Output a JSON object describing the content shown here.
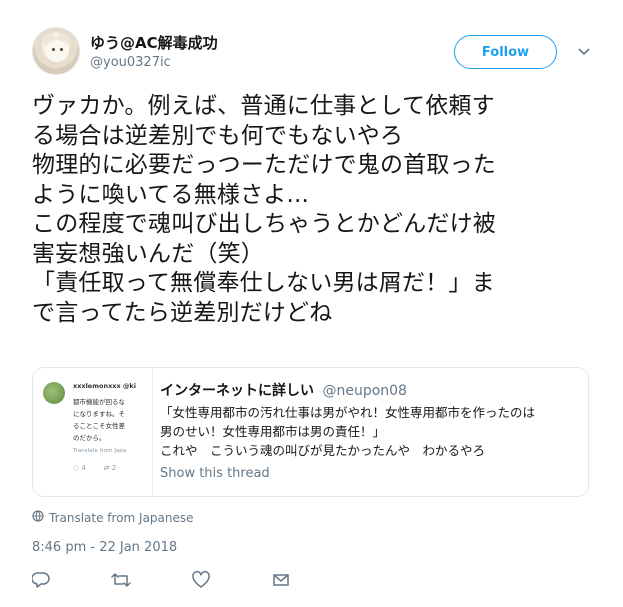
{
  "user": {
    "display_name": "ゆう@AC解毒成功",
    "handle": "@you0327ic"
  },
  "follow_button": {
    "label": "Follow"
  },
  "icons": {
    "caret": "chevron-down-icon",
    "translate": "globe-icon",
    "reply": "reply-icon",
    "retweet": "retweet-icon",
    "like": "heart-icon",
    "dm": "envelope-icon"
  },
  "tweet": {
    "text": "ヴァカか。例えば、普通に仕事として依頼す\nる場合は逆差別でも何でもないやろ\n物理的に必要だっつーただけで鬼の首取った\nように喚いてる無様さよ...\nこの程度で魂叫び出しちゃうとかどんだけ被\n害妄想強いんだ（笑）\n「責任取って無償奉仕しない男は屑だ！」ま\nで言ってたら逆差別だけどね"
  },
  "quoted_tweet": {
    "thumbnail": {
      "name": "xxxlemonxxx @ki",
      "lines": [
        "都市機能が回るな",
        "になりますね。そ",
        "ることこそ女性差",
        "のだから。"
      ],
      "translate": "Translate from Japa",
      "reply_count": "4",
      "retweet_count": "2"
    },
    "author_name": "インターネットに詳しい",
    "author_handle": "@neupon08",
    "text": "「女性専用都市の汚れ仕事は男がやれ！女性専用都市を作ったのは\n男のせい！女性専用都市は男の責任！」\nこれや　こういう魂の叫びが見たかったんや　わかるやろ",
    "show_thread": "Show this thread"
  },
  "translate_label": "Translate from Japanese",
  "timestamp": "8:46 pm - 22 Jan 2018",
  "colors": {
    "accent": "#1da1f2",
    "secondary_text": "#657786",
    "border": "#e1e8ed"
  }
}
